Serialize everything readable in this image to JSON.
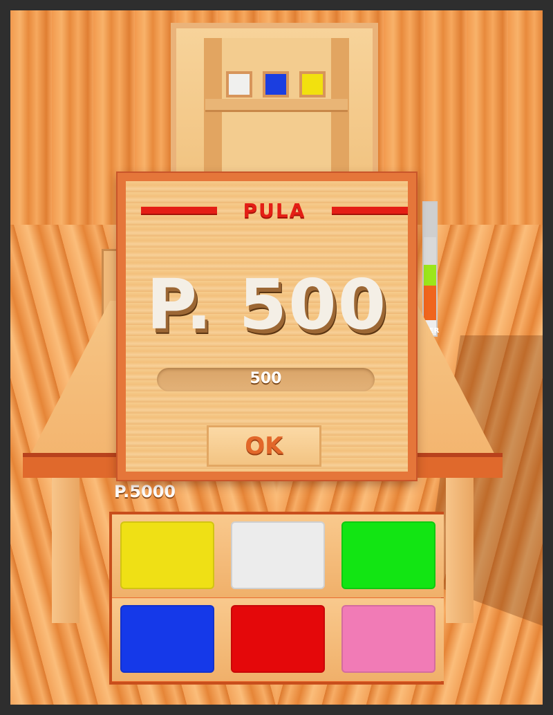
{
  "dialog": {
    "title": "PULA",
    "amount_text": "P. 500",
    "slider_value": "500",
    "ok_label": "OK"
  },
  "background": {
    "ghost_amount": "P.5000",
    "ghost_label": "VER"
  },
  "board_colors": [
    "#f0f0ee",
    "#1b3ee0",
    "#f2e10e"
  ],
  "palette": [
    {
      "name": "yellow",
      "color": "#efe015"
    },
    {
      "name": "white",
      "color": "#ececec"
    },
    {
      "name": "green",
      "color": "#12e513"
    },
    {
      "name": "blue",
      "color": "#1539e9"
    },
    {
      "name": "red",
      "color": "#e4080a"
    },
    {
      "name": "pink",
      "color": "#f17bb6"
    }
  ],
  "colors": {
    "accent_red": "#e41e15",
    "frame_orange": "#e5763a"
  }
}
